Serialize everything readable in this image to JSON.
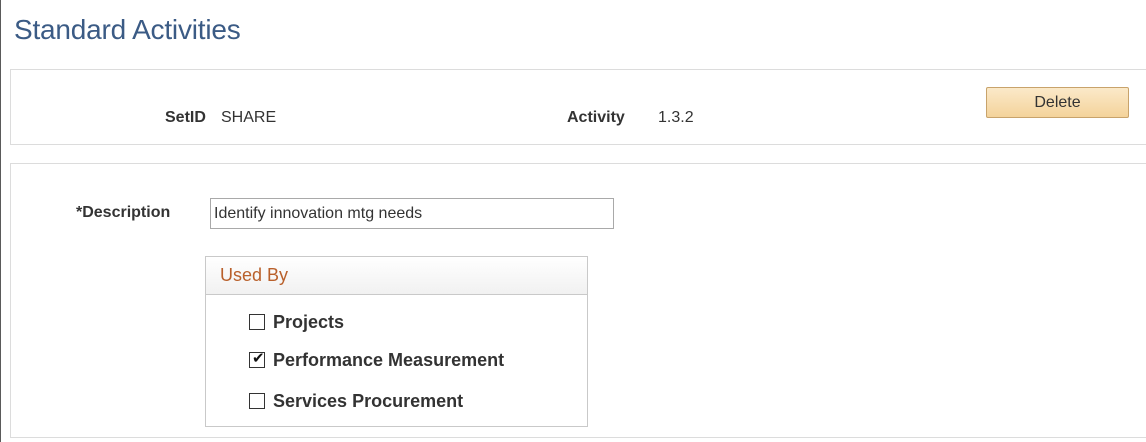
{
  "page": {
    "title": "Standard Activities"
  },
  "header": {
    "setid_label": "SetID",
    "setid_value": "SHARE",
    "activity_label": "Activity",
    "activity_value": "1.3.2",
    "delete_label": "Delete"
  },
  "form": {
    "description_label": "*Description",
    "description_value": "Identify innovation mtg needs"
  },
  "used_by": {
    "title": "Used By",
    "options": [
      {
        "label": "Projects",
        "checked": false
      },
      {
        "label": "Performance Measurement",
        "checked": true
      },
      {
        "label": "Services Procurement",
        "checked": false
      }
    ]
  },
  "icons": {
    "checked_glyph": "checkmark-icon"
  }
}
